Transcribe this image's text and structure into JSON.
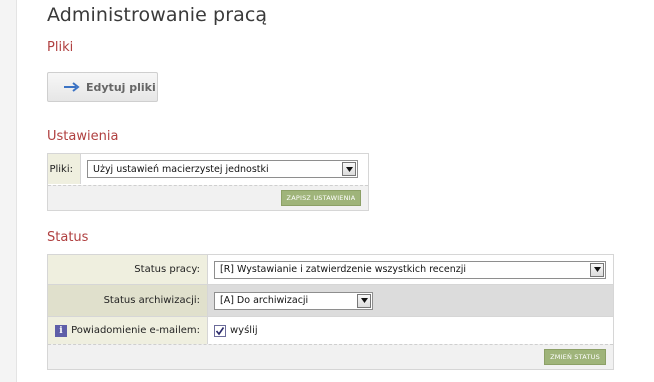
{
  "page": {
    "title": "Administrowanie pracą"
  },
  "files_section": {
    "title": "Pliki",
    "edit_button_label": "Edytuj pliki"
  },
  "settings_section": {
    "title": "Ustawienia",
    "files_label": "Pliki:",
    "files_selected": "Użyj ustawień macierzystej jednostki",
    "save_button_label": "ZAPISZ USTAWIENIA"
  },
  "status_section": {
    "title": "Status",
    "work_status_label": "Status pracy:",
    "work_status_selected": "[R] Wystawianie i zatwierdzenie wszystkich recenzji",
    "archive_status_label": "Status archiwizacji:",
    "archive_status_selected": "[A] Do archiwizacji",
    "email_label": "Powiadomienie e-mailem:",
    "email_checkbox_label": "wyślij",
    "email_checked": true,
    "info_icon_glyph": "i",
    "change_button_label": "ZMIEŃ STATUS"
  },
  "colors": {
    "section_title": "#b04040",
    "action_button": "#9fb47a",
    "label_cell": "#efefdf"
  }
}
